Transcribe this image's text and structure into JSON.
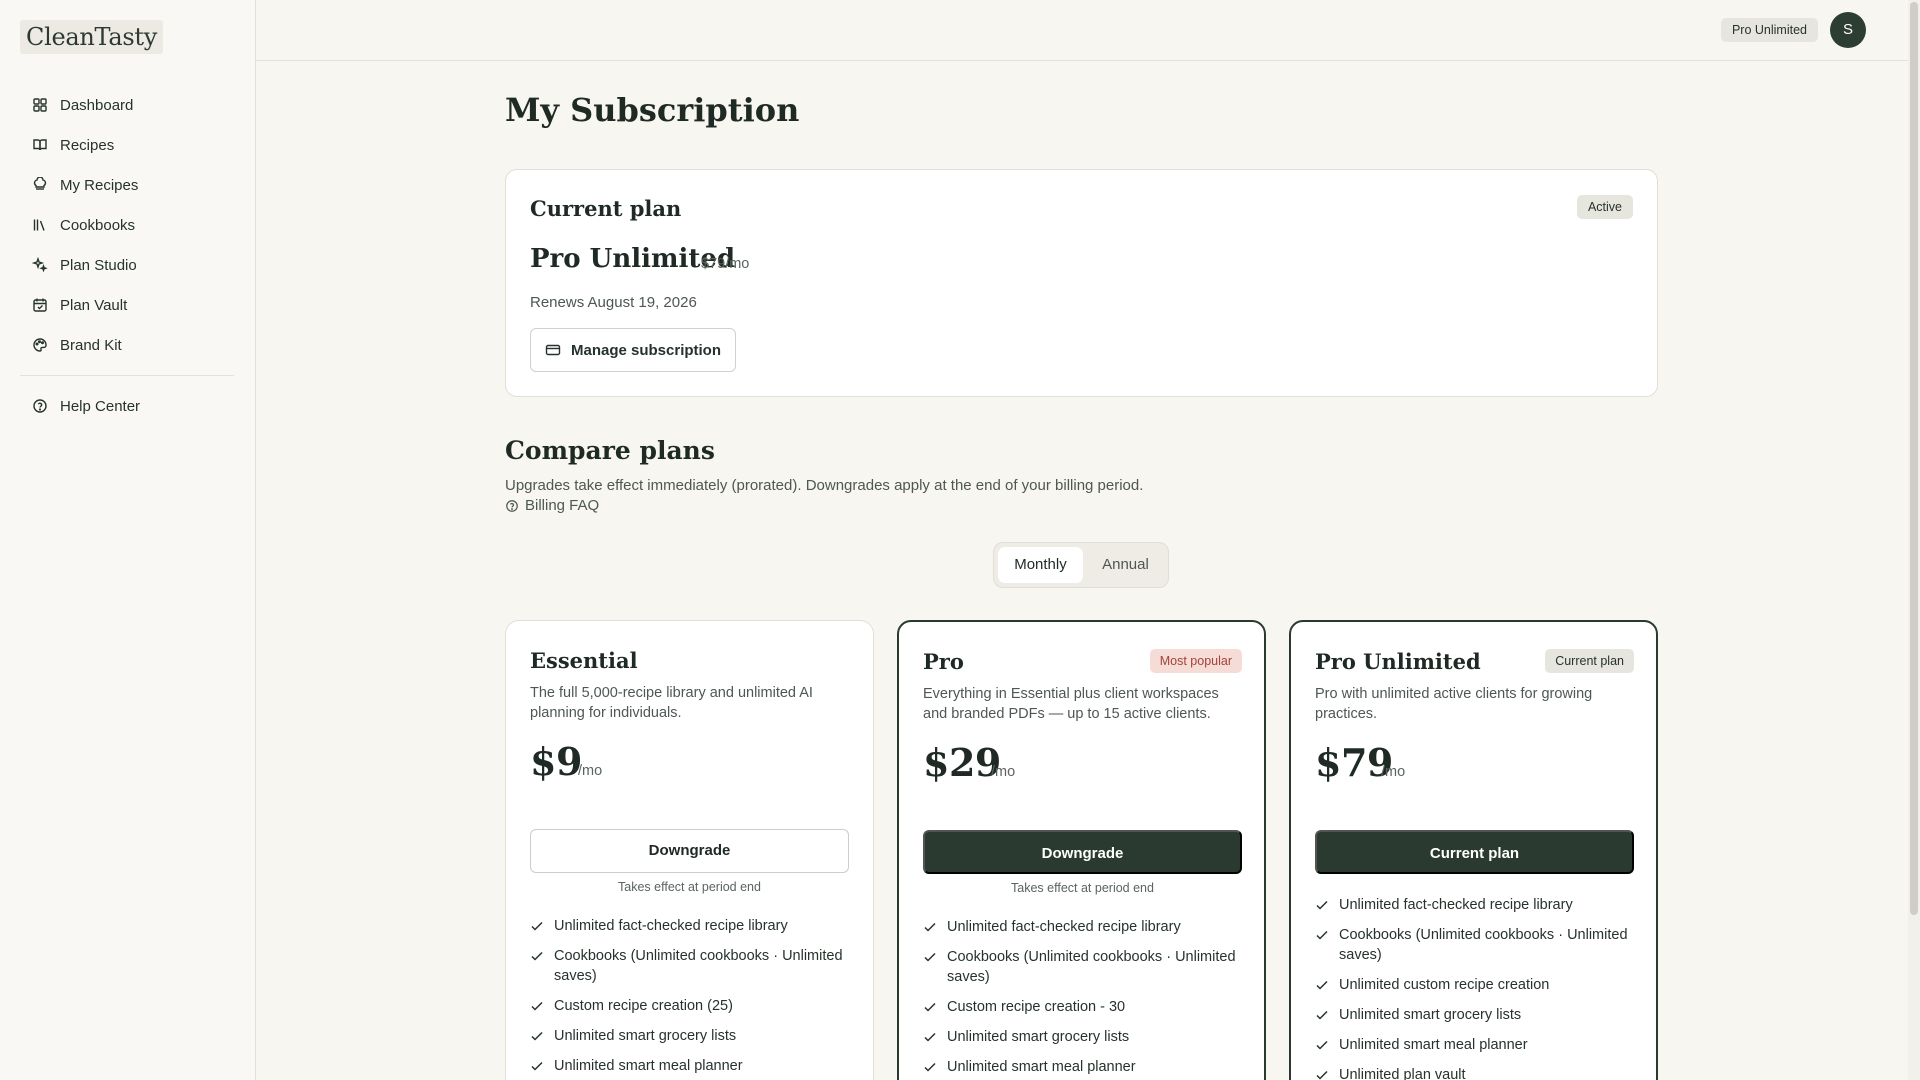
{
  "app": {
    "logo": "CleanTasty"
  },
  "sidebar": {
    "items": [
      {
        "label": "Dashboard",
        "icon": "grid-icon"
      },
      {
        "label": "Recipes",
        "icon": "book-open-icon"
      },
      {
        "label": "My Recipes",
        "icon": "chef-hat-icon"
      },
      {
        "label": "Cookbooks",
        "icon": "library-icon"
      },
      {
        "label": "Plan Studio",
        "icon": "sparkles-icon"
      },
      {
        "label": "Plan Vault",
        "icon": "calendar-check-icon"
      },
      {
        "label": "Brand Kit",
        "icon": "palette-icon"
      }
    ],
    "help": {
      "label": "Help Center",
      "icon": "help-circle-icon"
    }
  },
  "topbar": {
    "plan_badge": "Pro Unlimited",
    "avatar_initial": "S"
  },
  "page": {
    "title": "My Subscription"
  },
  "current_plan": {
    "heading": "Current plan",
    "status": "Active",
    "name": "Pro Unlimited",
    "price": "$79/mo",
    "renews": "Renews August 19, 2026",
    "manage_label": "Manage subscription"
  },
  "compare": {
    "title": "Compare plans",
    "subtitle": "Upgrades take effect immediately (prorated). Downgrades apply at the end of your billing period.",
    "faq_label": "Billing FAQ",
    "toggle": {
      "monthly": "Monthly",
      "annual": "Annual",
      "selected": "Monthly"
    }
  },
  "plans": [
    {
      "name": "Essential",
      "badge": "",
      "description": "The full 5,000-recipe library and unlimited AI planning for individuals.",
      "price": "$9",
      "per": "/mo",
      "button": "Downgrade",
      "note": "Takes effect at period end",
      "features": [
        "Unlimited fact-checked recipe library",
        "Cookbooks (Unlimited cookbooks · Unlimited saves)",
        "Custom recipe creation (25)",
        "Unlimited smart grocery lists",
        "Unlimited smart meal planner"
      ]
    },
    {
      "name": "Pro",
      "badge": "Most popular",
      "description": "Everything in Essential plus client workspaces and branded PDFs — up to 15 active clients.",
      "price": "$29",
      "per": "/mo",
      "button": "Downgrade",
      "note": "Takes effect at period end",
      "features": [
        "Unlimited fact-checked recipe library",
        "Cookbooks (Unlimited cookbooks · Unlimited saves)",
        "Custom recipe creation - 30",
        "Unlimited smart grocery lists",
        "Unlimited smart meal planner"
      ]
    },
    {
      "name": "Pro Unlimited",
      "badge": "Current plan",
      "description": "Pro with unlimited active clients for growing practices.",
      "price": "$79",
      "per": "/mo",
      "button": "Current plan",
      "note": "",
      "features": [
        "Unlimited fact-checked recipe library",
        "Cookbooks (Unlimited cookbooks · Unlimited saves)",
        "Unlimited custom recipe creation",
        "Unlimited smart grocery lists",
        "Unlimited smart meal planner",
        "Unlimited plan vault"
      ]
    }
  ],
  "colors": {
    "accent": "#2a3a31",
    "background": "#f7f6f1",
    "popular_badge_bg": "#f6dcd6",
    "popular_badge_text": "#a3423b"
  }
}
